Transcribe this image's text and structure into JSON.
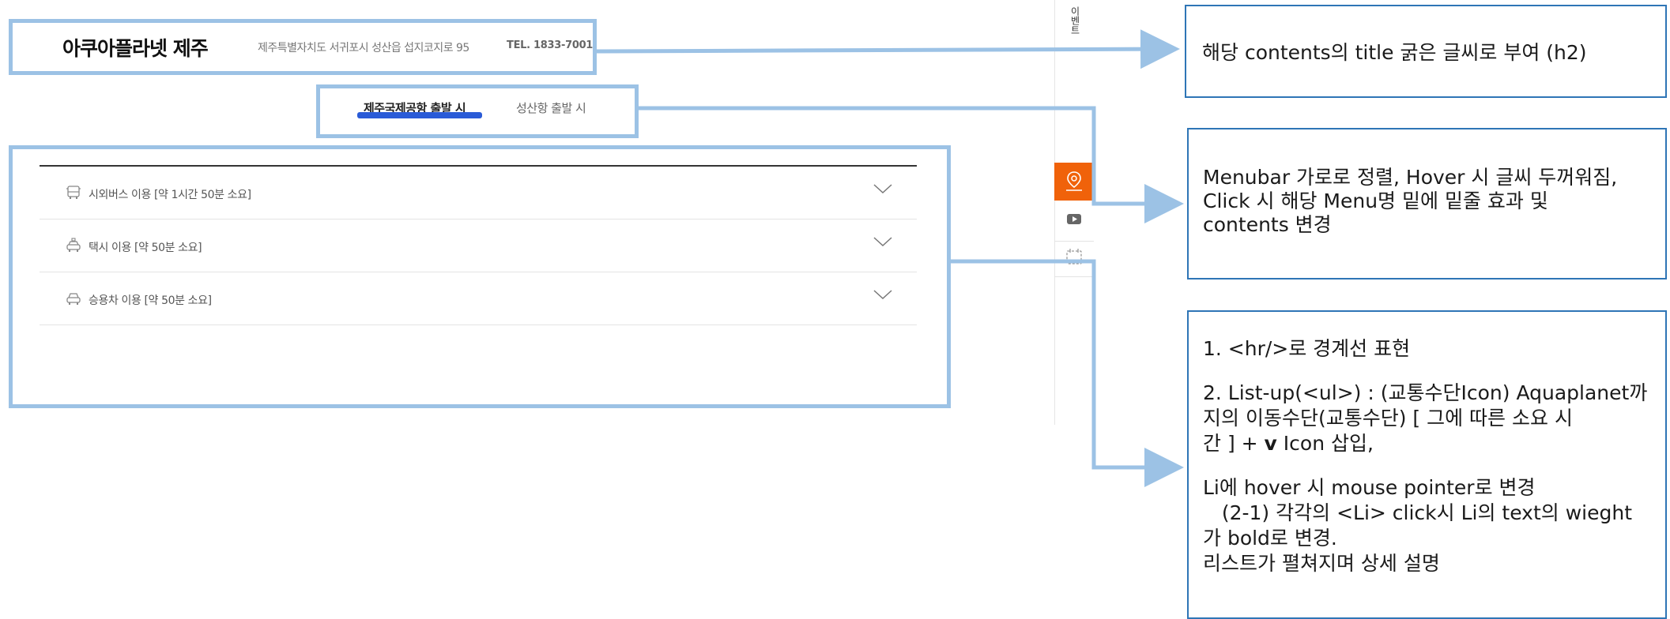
{
  "header": {
    "brand": "아쿠아플라넷 제주",
    "address": "제주특별자치도 서귀포시 성산읍 섭지코지로 95",
    "tel": "TEL. 1833-7001"
  },
  "tabs": [
    {
      "label": "제주국제공항 출발 시",
      "active": true
    },
    {
      "label": "성산항 출발 시",
      "active": false
    }
  ],
  "routes": [
    {
      "label": "시외버스 이용 [약 1시간 50분 소요]",
      "icon": "bus-icon"
    },
    {
      "label": "택시 이용 [약 50분 소요]",
      "icon": "taxi-icon"
    },
    {
      "label": "승용차 이용 [약 50분 소요]",
      "icon": "car-icon"
    }
  ],
  "rail": {
    "top_label": "이벤트",
    "buttons": [
      "map-pin-icon",
      "play-icon",
      "calendar-icon"
    ]
  },
  "notes": {
    "n1": "해당 contents의 title 굵은 글씨로 부여 (h2)",
    "n2": {
      "line1": "Menubar 가로로 정렬, Hover 시 글씨 두꺼워짐,",
      "line2": "Click 시 해당 Menu명 밑에 밑줄 효과 및",
      "line3": "contents 변경"
    },
    "n3": {
      "line1": "1.   <hr/>로 경계선 표현",
      "line2": "2. List-up(<ul>) : (교통수단Icon) Aquaplanet까",
      "line3": "지의 이동수단(교통수단) [ 그에 따른 소요 시",
      "line4": "간 ] + ",
      "line4_bold": "v",
      "line4_tail": " Icon 삽입,",
      "line5": "Li에 hover 시 mouse pointer로 변경",
      "line6": "   (2-1) 각각의 <Li> click시 Li의 text의 wieght",
      "line7": "가 bold로 변경.",
      "line8": "리스트가 펼쳐지며 상세 설명"
    }
  },
  "colors": {
    "annotation_frame": "#9cc2e5",
    "note_border": "#2e75b6",
    "tab_underline": "#2a5bd7",
    "rail_active": "#f0620a"
  }
}
